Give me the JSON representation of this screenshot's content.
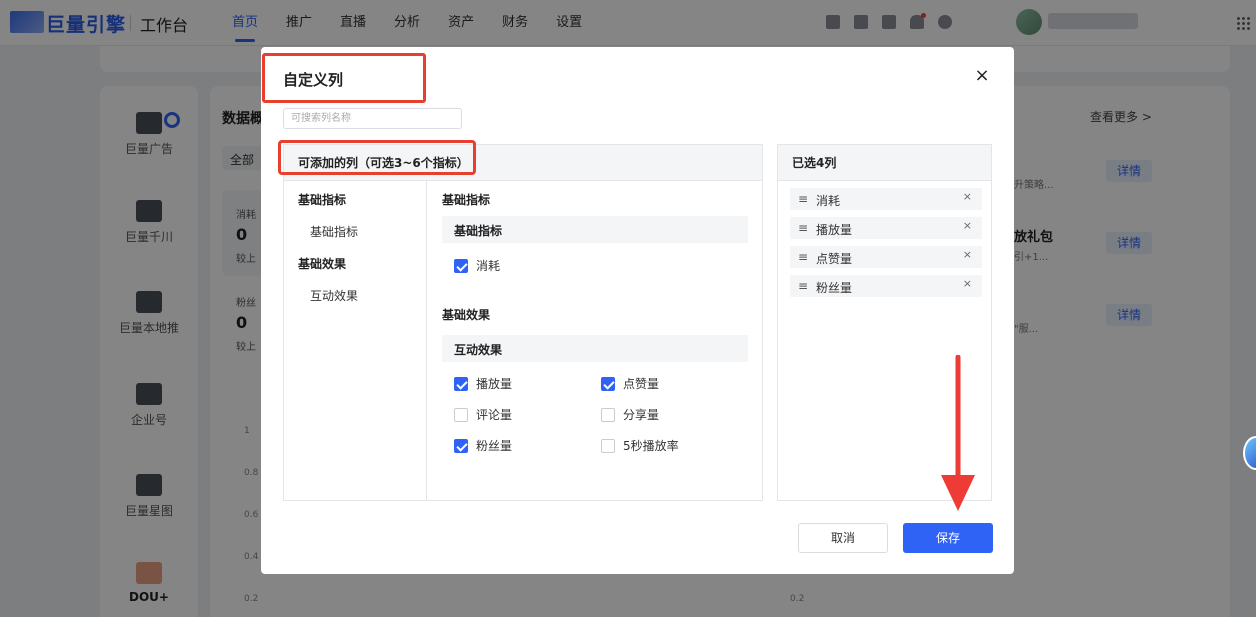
{
  "topbar": {
    "logo_text": "巨量引擎",
    "logo_sub": "工作台",
    "nav": [
      {
        "label": "首页",
        "active": true
      },
      {
        "label": "推广",
        "active": false
      },
      {
        "label": "直播",
        "active": false
      },
      {
        "label": "分析",
        "active": false
      },
      {
        "label": "资产",
        "active": false
      },
      {
        "label": "财务",
        "active": false
      },
      {
        "label": "设置",
        "active": false
      }
    ],
    "icons": [
      "phone-icon",
      "clipboard-icon",
      "chart-icon",
      "bell-icon",
      "help-icon"
    ]
  },
  "background": {
    "rail": [
      {
        "label": "巨量广告",
        "icon": "ad-icon"
      },
      {
        "label": "巨量千川",
        "icon": "qianchuan-icon"
      },
      {
        "label": "巨量本地推",
        "icon": "location-icon"
      },
      {
        "label": "企业号",
        "icon": "enterprise-icon"
      },
      {
        "label": "巨量星图",
        "icon": "star-map-icon"
      },
      {
        "label": "DOU+",
        "icon": "dou-plus-icon"
      }
    ],
    "section_title": "数据概",
    "more_link": "查看更多 >",
    "tab": "全部",
    "metric1": {
      "label": "消耗",
      "value": "0",
      "compare": "较上"
    },
    "metric2": {
      "label": "粉丝",
      "value": "0",
      "compare": "较上"
    },
    "y_ticks_left": [
      "1",
      "0.8",
      "0.6",
      "0.4",
      "0.2"
    ],
    "y_tick_right": "0.2",
    "detail_label": "详情",
    "promo_title": "放礼包",
    "promo_subs": [
      "升策略...",
      "引+1...",
      "\"服..."
    ]
  },
  "modal": {
    "title": "自定义列",
    "close_icon": "close-icon",
    "search_placeholder": "可搜索列名称",
    "available_header": "可添加的列（可选3~6个指标）",
    "categories": [
      {
        "group": "基础指标",
        "item": "基础指标"
      },
      {
        "group": "基础效果",
        "item": "互动效果"
      }
    ],
    "sections": {
      "basic": {
        "title": "基础指标",
        "sub": "基础指标",
        "metrics": [
          {
            "label": "消耗",
            "checked": true
          }
        ]
      },
      "effect": {
        "title": "基础效果",
        "sub": "互动效果",
        "metrics": [
          {
            "label": "播放量",
            "checked": true
          },
          {
            "label": "点赞量",
            "checked": true
          },
          {
            "label": "评论量",
            "checked": false
          },
          {
            "label": "分享量",
            "checked": false
          },
          {
            "label": "粉丝量",
            "checked": true
          },
          {
            "label": "5秒播放率",
            "checked": false
          }
        ]
      }
    },
    "selected_header": "已选4列",
    "selected": [
      {
        "label": "消耗"
      },
      {
        "label": "播放量"
      },
      {
        "label": "点赞量"
      },
      {
        "label": "粉丝量"
      }
    ],
    "cancel_label": "取消",
    "save_label": "保存"
  },
  "colors": {
    "accent": "#2f63f5",
    "highlight": "#e8402f",
    "arrow": "#ee3b36"
  }
}
